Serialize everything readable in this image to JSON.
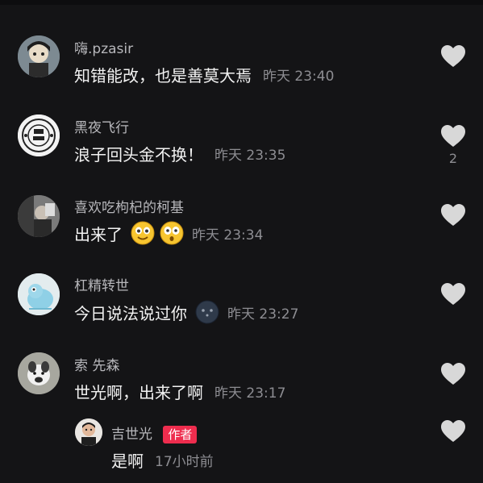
{
  "comments": [
    {
      "username": "嗨.pzasir",
      "text": "知错能改，也是善莫大焉",
      "time": "昨天 23:40",
      "likes": ""
    },
    {
      "username": "黑夜飞行",
      "text": "浪子回头金不换！",
      "time": "昨天 23:35",
      "likes": "2"
    },
    {
      "username": "喜欢吃枸杞的柯基",
      "text": "出来了",
      "time": "昨天 23:34",
      "likes": ""
    },
    {
      "username": "杠精转世",
      "text": "今日说法说过你",
      "time": "昨天 23:27",
      "likes": ""
    },
    {
      "username": "索 先森",
      "text": "世光啊，出来了啊",
      "time": "昨天 23:17",
      "likes": ""
    }
  ],
  "reply": {
    "username": "吉世光",
    "badge": "作者",
    "text": "是啊",
    "time": "17小时前"
  },
  "colors": {
    "background": "#141416",
    "badge": "#ee2d4e",
    "heart": "#d8d8d8"
  },
  "icons": {
    "like": "heart-icon",
    "emoji_smile": "smiling-face-emoji",
    "emoji_surprise": "surprised-face-emoji",
    "emoji_dark": "dark-face-emoji"
  }
}
